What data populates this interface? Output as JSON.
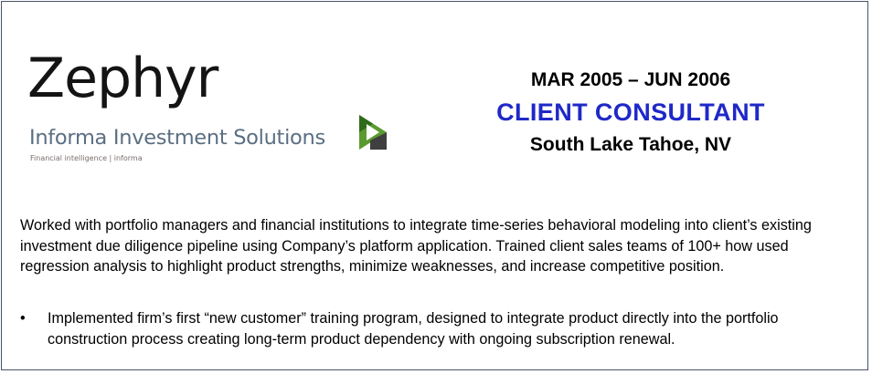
{
  "logo": {
    "wordmark": "Zephyr",
    "subtitle": "Informa Investment Solutions",
    "tagline": "Financial intelligence | informa",
    "mark_color": "#5a9a2e",
    "icon": "green-play-arrow-icon"
  },
  "role": {
    "dates": "MAR 2005 – JUN 2006",
    "title": "CLIENT CONSULTANT",
    "title_color": "#1f28c8",
    "location": "South Lake Tahoe, NV"
  },
  "summary": "Worked with portfolio managers and financial institutions to integrate time-series behavioral modeling  into client’s existing investment due diligence pipeline using Company’s platform application. Trained client sales teams of 100+ how used regression analysis to highlight product strengths, minimize weaknesses, and increase competitive position.",
  "bullets": [
    {
      "marker": "•",
      "text": "Implemented firm’s first “new customer” training program, designed to integrate product directly into the portfolio construction process creating long-term product dependency with ongoing subscription renewal."
    }
  ]
}
